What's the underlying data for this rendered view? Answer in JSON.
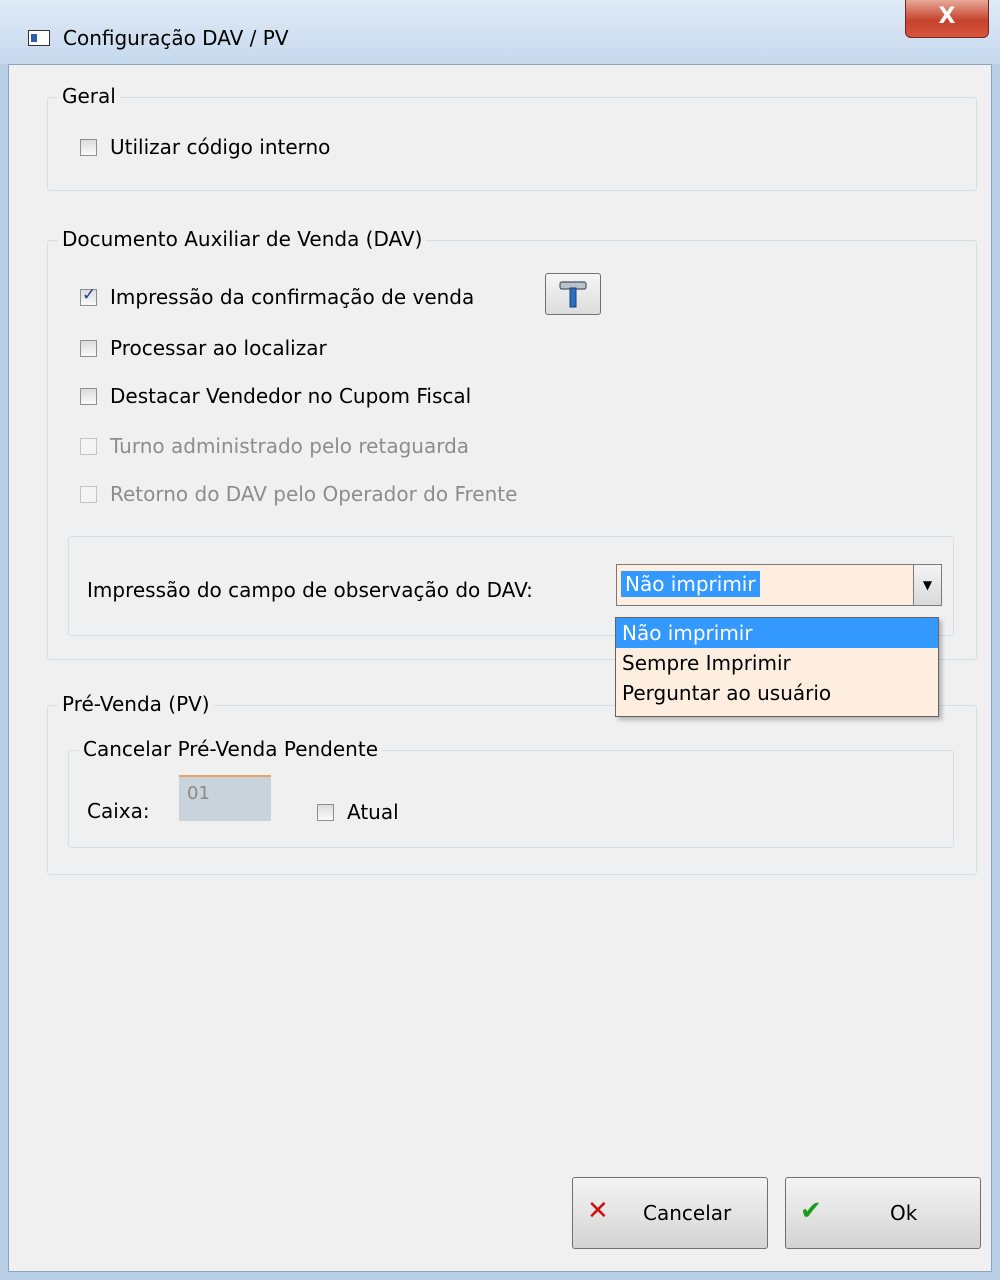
{
  "window": {
    "title": "Configuração DAV / PV",
    "close_glyph": "X"
  },
  "geral": {
    "title": "Geral",
    "utilizar_codigo_interno": {
      "label": "Utilizar código interno",
      "checked": false
    }
  },
  "dav": {
    "title": "Documento Auxiliar de Venda (DAV)",
    "impressao_confirmacao": {
      "label": "Impressão da confirmação de venda",
      "checked": true
    },
    "processar_localizar": {
      "label": "Processar ao localizar",
      "checked": false
    },
    "destacar_vendedor": {
      "label": "Destacar Vendedor no Cupom Fiscal",
      "checked": false
    },
    "turno_administrado": {
      "label": "Turno administrado pelo retaguarda",
      "checked": false,
      "disabled": true
    },
    "retorno_dav": {
      "label": "Retorno do DAV pelo Operador do Frente",
      "checked": false,
      "disabled": true
    },
    "observacao": {
      "label": "Impressão do campo de observação do DAV:",
      "selected": "Não imprimir",
      "options": [
        "Não imprimir",
        "Sempre Imprimir",
        "Perguntar ao usuário"
      ]
    }
  },
  "pv": {
    "title": "Pré-Venda (PV)",
    "cancelar_group": {
      "title": "Cancelar Pré-Venda Pendente",
      "caixa_label": "Caixa:",
      "caixa_value": "01",
      "atual": {
        "label": "Atual",
        "checked": false
      }
    }
  },
  "buttons": {
    "cancelar": {
      "label": "Cancelar",
      "icon": "x-icon"
    },
    "ok": {
      "label": "Ok",
      "icon": "check-icon"
    }
  },
  "colors": {
    "selection": "#3399ff",
    "combo_background": "#fdeee0",
    "cancel_icon": "#d01010",
    "ok_icon": "#1b9a1b"
  }
}
